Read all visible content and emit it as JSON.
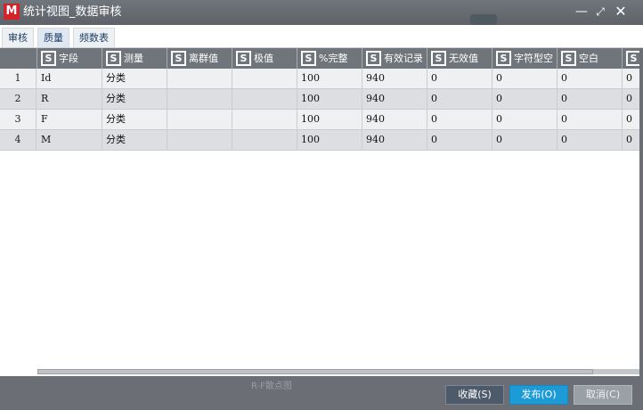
{
  "window": {
    "logo_letter": "M",
    "title": "统计视图_数据审核"
  },
  "tabs": [
    {
      "label": "审核"
    },
    {
      "label": "质量"
    },
    {
      "label": "频数表"
    }
  ],
  "table": {
    "icon_letter": "S",
    "columns": [
      "字段",
      "测量",
      "离群值",
      "极值",
      "%完整",
      "有效记录",
      "无效值",
      "字符型空",
      "空白",
      ""
    ],
    "rows": [
      {
        "num": "1",
        "cells": [
          "Id",
          "分类",
          "",
          "",
          "100",
          "940",
          "0",
          "0",
          "0",
          "0"
        ]
      },
      {
        "num": "2",
        "cells": [
          "R",
          "分类",
          "",
          "",
          "100",
          "940",
          "0",
          "0",
          "0",
          "0"
        ]
      },
      {
        "num": "3",
        "cells": [
          "F",
          "分类",
          "",
          "",
          "100",
          "940",
          "0",
          "0",
          "0",
          "0"
        ]
      },
      {
        "num": "4",
        "cells": [
          "M",
          "分类",
          "",
          "",
          "100",
          "940",
          "0",
          "0",
          "0",
          "0"
        ]
      }
    ]
  },
  "background_text": "R-F散点图",
  "buttons": {
    "favorite": "收藏(S)",
    "publish": "发布(O)",
    "cancel": "取消(C)"
  }
}
